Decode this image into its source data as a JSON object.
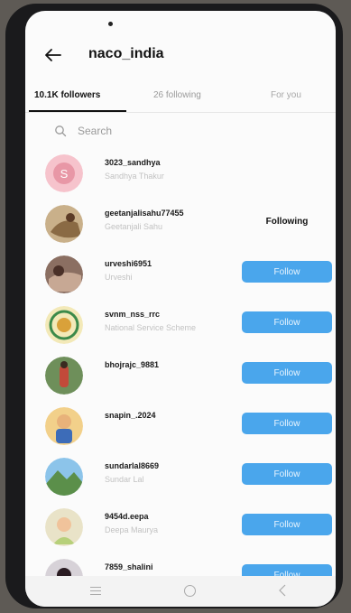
{
  "header": {
    "title": "naco_india"
  },
  "tabs": [
    {
      "label": "10.1K followers",
      "active": true
    },
    {
      "label": "26 following",
      "active": false
    },
    {
      "label": "For you",
      "active": false
    }
  ],
  "search": {
    "placeholder": "Search"
  },
  "users": [
    {
      "username": "3023_sandhya",
      "subtitle": "Sandhya Thakur",
      "action": "",
      "avatar_icon": "letter-s-avatar",
      "avatar_letter": "S"
    },
    {
      "username": "geetanjalisahu77455",
      "subtitle": "Geetanjali Sahu",
      "action": "Following",
      "avatar_icon": "photo-avatar"
    },
    {
      "username": "urveshi6951",
      "subtitle": "Urveshi",
      "action": "Follow",
      "avatar_icon": "photo-avatar"
    },
    {
      "username": "svnm_nss_rrc",
      "subtitle": "National Service Scheme",
      "action": "Follow",
      "avatar_icon": "emblem-avatar"
    },
    {
      "username": "bhojrajc_9881",
      "subtitle": "",
      "action": "Follow",
      "avatar_icon": "photo-avatar"
    },
    {
      "username": "snapin_.2024",
      "subtitle": "",
      "action": "Follow",
      "avatar_icon": "photo-avatar"
    },
    {
      "username": "sundarlal8669",
      "subtitle": "Sundar Lal",
      "action": "Follow",
      "avatar_icon": "landscape-avatar"
    },
    {
      "username": "9454d.eepa",
      "subtitle": "Deepa Maurya",
      "action": "Follow",
      "avatar_icon": "photo-avatar"
    },
    {
      "username": "7859_shalini",
      "subtitle": "",
      "action": "Follow",
      "avatar_icon": "photo-avatar"
    }
  ],
  "colors": {
    "follow_button": "#4aa6ec",
    "background": "#fbfbfb"
  },
  "navbar": {
    "icons": [
      "menu-icon",
      "home-circle-icon",
      "back-chevron-icon"
    ]
  }
}
